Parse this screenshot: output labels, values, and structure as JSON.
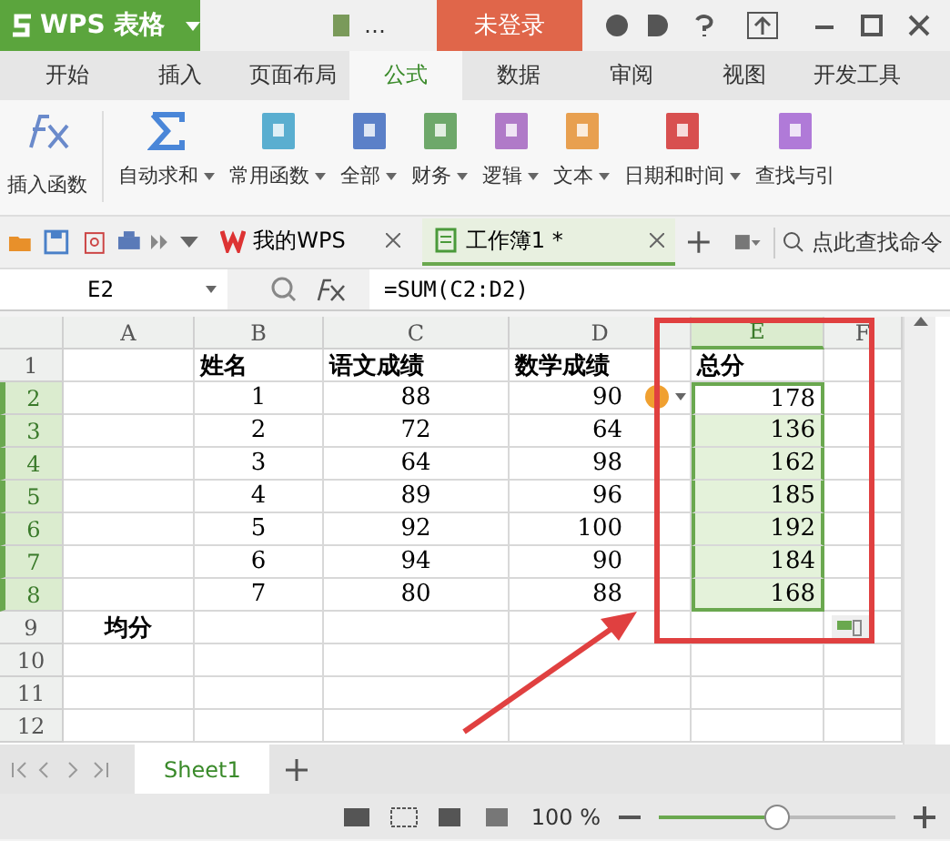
{
  "app": {
    "name": "WPS 表格",
    "login": "未登录",
    "more": "…"
  },
  "ribbon_tabs": [
    {
      "label": "开始",
      "selected": false
    },
    {
      "label": "插入",
      "selected": false
    },
    {
      "label": "页面布局",
      "selected": false
    },
    {
      "label": "公式",
      "selected": true
    },
    {
      "label": "数据",
      "selected": false
    },
    {
      "label": "审阅",
      "selected": false
    },
    {
      "label": "视图",
      "selected": false
    },
    {
      "label": "开发工具",
      "selected": false
    }
  ],
  "ribbon_tools": [
    {
      "label": "插入函数",
      "kind": "fx",
      "dropdown": false
    },
    {
      "label": "自动求和",
      "kind": "sigma",
      "dropdown": true,
      "color": "#4a86d8"
    },
    {
      "label": "常用函数",
      "kind": "book",
      "dropdown": true,
      "color": "#5aaed0"
    },
    {
      "label": "全部",
      "kind": "book",
      "dropdown": true,
      "color": "#5b80c8"
    },
    {
      "label": "财务",
      "kind": "book",
      "dropdown": true,
      "color": "#6ea86a"
    },
    {
      "label": "逻辑",
      "kind": "book",
      "dropdown": true,
      "color": "#b07ac8"
    },
    {
      "label": "文本",
      "kind": "book",
      "dropdown": true,
      "color": "#e8a050"
    },
    {
      "label": "日期和时间",
      "kind": "book",
      "dropdown": true,
      "color": "#d85050"
    },
    {
      "label": "查找与引",
      "kind": "book",
      "dropdown": false,
      "color": "#b07ad8"
    }
  ],
  "doc_tabs": [
    {
      "label": "我的WPS",
      "kind": "wps",
      "selected": false
    },
    {
      "label": "工作簿1 *",
      "kind": "sheet",
      "selected": true
    }
  ],
  "search": {
    "placeholder": "点此查找命令"
  },
  "formula_bar": {
    "cell": "E2",
    "formula": "=SUM(C2:D2)"
  },
  "columns": [
    {
      "label": "A",
      "selected": false
    },
    {
      "label": "B",
      "selected": false
    },
    {
      "label": "C",
      "selected": false
    },
    {
      "label": "D",
      "selected": false
    },
    {
      "label": "E",
      "selected": true
    },
    {
      "label": "F",
      "selected": false
    }
  ],
  "rows": [
    {
      "label": "1",
      "selected": false,
      "kind": "heading",
      "cells": [
        "",
        "姓名",
        "语文成绩",
        "数学成绩",
        "总分",
        ""
      ]
    },
    {
      "label": "2",
      "selected": true,
      "kind": "data",
      "warning": true,
      "cells": [
        "",
        "1",
        "88",
        "90",
        "178",
        ""
      ]
    },
    {
      "label": "3",
      "selected": true,
      "kind": "data",
      "cells": [
        "",
        "2",
        "72",
        "64",
        "136",
        ""
      ]
    },
    {
      "label": "4",
      "selected": true,
      "kind": "data",
      "cells": [
        "",
        "3",
        "64",
        "98",
        "162",
        ""
      ]
    },
    {
      "label": "5",
      "selected": true,
      "kind": "data",
      "cells": [
        "",
        "4",
        "89",
        "96",
        "185",
        ""
      ]
    },
    {
      "label": "6",
      "selected": true,
      "kind": "data",
      "cells": [
        "",
        "5",
        "92",
        "100",
        "192",
        ""
      ]
    },
    {
      "label": "7",
      "selected": true,
      "kind": "data",
      "cells": [
        "",
        "6",
        "94",
        "90",
        "184",
        ""
      ]
    },
    {
      "label": "8",
      "selected": true,
      "kind": "data",
      "cells": [
        "",
        "7",
        "80",
        "88",
        "168",
        ""
      ]
    },
    {
      "label": "9",
      "selected": false,
      "kind": "heading",
      "fill_options": true,
      "cells": [
        "均分",
        "",
        "",
        "",
        "",
        ""
      ]
    },
    {
      "label": "10",
      "selected": false,
      "kind": "data",
      "cells": [
        "",
        "",
        "",
        "",
        "",
        ""
      ]
    },
    {
      "label": "11",
      "selected": false,
      "kind": "data",
      "cells": [
        "",
        "",
        "",
        "",
        "",
        ""
      ]
    },
    {
      "label": "12",
      "selected": false,
      "kind": "data",
      "cells": [
        "",
        "",
        "",
        "",
        "",
        ""
      ]
    }
  ],
  "sheets": [
    {
      "label": "Sheet1",
      "selected": true
    }
  ],
  "status": {
    "zoom": "100 %",
    "level": 0.5
  }
}
